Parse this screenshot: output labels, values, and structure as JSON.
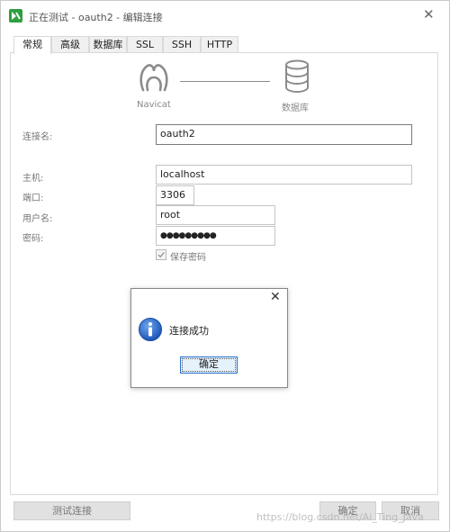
{
  "window": {
    "title": "正在测试 - oauth2 - 编辑连接",
    "close_glyph": "✕"
  },
  "tabs": [
    {
      "label": "常规",
      "active": true
    },
    {
      "label": "高级"
    },
    {
      "label": "数据库"
    },
    {
      "label": "SSL"
    },
    {
      "label": "SSH"
    },
    {
      "label": "HTTP"
    }
  ],
  "diagram": {
    "left_caption": "Navicat",
    "right_caption": "数据库",
    "left_icon": "navicat-icon",
    "right_icon": "database-icon"
  },
  "form": {
    "conn_name_label": "连接名:",
    "conn_name_value": "oauth2",
    "host_label": "主机:",
    "host_value": "localhost",
    "port_label": "端口:",
    "port_value": "3306",
    "user_label": "用户名:",
    "user_value": "root",
    "password_label": "密码:",
    "password_value": "●●●●●●●●●",
    "save_password_label": "保存密码",
    "save_password_checked": true
  },
  "dialog": {
    "message": "连接成功",
    "ok_label": "确定",
    "close_glyph": "✕",
    "icon": "info-icon"
  },
  "footer": {
    "test_label": "测试连接",
    "ok_label": "确定",
    "cancel_label": "取消"
  },
  "watermark": "https://blog.csdn.net/Ai_Ting_Java",
  "colors": {
    "accent": "#2a6fc9",
    "icon_gray": "#8c8c8c",
    "brand_green": "#2f9e41"
  }
}
